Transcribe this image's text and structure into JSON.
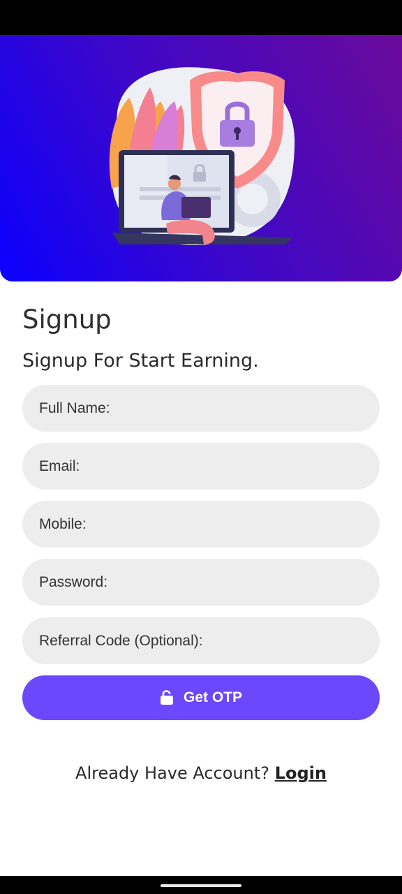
{
  "header": {
    "title": "Signup",
    "subtitle": "Signup For Start Earning."
  },
  "hero": {
    "illustration": "security-laptop-illustration"
  },
  "form": {
    "full_name_placeholder": "Full Name:",
    "email_placeholder": "Email:",
    "mobile_placeholder": "Mobile:",
    "password_placeholder": "Password:",
    "referral_placeholder": "Referral Code (Optional):"
  },
  "otp_button": {
    "label": "Get OTP",
    "icon": "unlock-icon"
  },
  "footer": {
    "prompt": "Already Have Account?",
    "login_label": "Login"
  },
  "colors": {
    "accent": "#6b48fd",
    "field_bg": "#ededed",
    "hero_start": "#0a00ff",
    "hero_end": "#6a0a9a"
  }
}
